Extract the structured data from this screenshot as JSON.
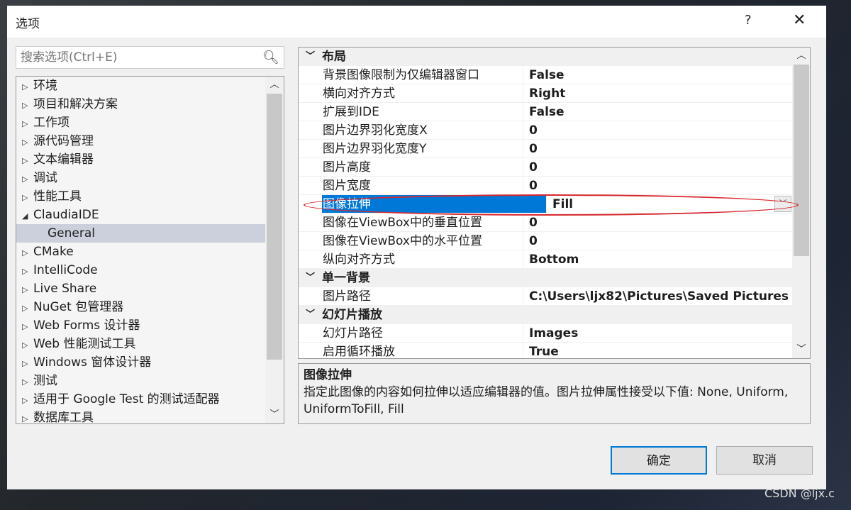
{
  "dialog": {
    "title": "选项",
    "help": "?",
    "close": "✕"
  },
  "search": {
    "placeholder": "搜索选项(Ctrl+E)"
  },
  "tree": {
    "items": [
      {
        "label": "环境",
        "arrow": "▷"
      },
      {
        "label": "项目和解决方案",
        "arrow": "▷"
      },
      {
        "label": "工作项",
        "arrow": "▷"
      },
      {
        "label": "源代码管理",
        "arrow": "▷"
      },
      {
        "label": "文本编辑器",
        "arrow": "▷"
      },
      {
        "label": "调试",
        "arrow": "▷"
      },
      {
        "label": "性能工具",
        "arrow": "▷"
      },
      {
        "label": "ClaudiaIDE",
        "arrow": "◢"
      },
      {
        "label": "General",
        "arrow": ""
      },
      {
        "label": "CMake",
        "arrow": "▷"
      },
      {
        "label": "IntelliCode",
        "arrow": "▷"
      },
      {
        "label": "Live Share",
        "arrow": "▷"
      },
      {
        "label": "NuGet 包管理器",
        "arrow": "▷"
      },
      {
        "label": "Web Forms 设计器",
        "arrow": "▷"
      },
      {
        "label": "Web 性能测试工具",
        "arrow": "▷"
      },
      {
        "label": "Windows 窗体设计器",
        "arrow": "▷"
      },
      {
        "label": "测试",
        "arrow": "▷"
      },
      {
        "label": "适用于 Google Test 的测试适配器",
        "arrow": "▷"
      },
      {
        "label": "数据库工具",
        "arrow": "▷"
      }
    ],
    "selected": "General"
  },
  "grid": {
    "rows": [
      {
        "cat": "布局"
      },
      {
        "name": "背景图像限制为仅编辑器窗口",
        "value": "False"
      },
      {
        "name": "横向对齐方式",
        "value": "Right"
      },
      {
        "name": "扩展到IDE",
        "value": "False"
      },
      {
        "name": "图片边界羽化宽度X",
        "value": "0"
      },
      {
        "name": "图片边界羽化宽度Y",
        "value": "0"
      },
      {
        "name": "图片高度",
        "value": "0"
      },
      {
        "name": "图片宽度",
        "value": "0"
      },
      {
        "name": "图像拉伸",
        "value": "Fill",
        "selected": true
      },
      {
        "name": "图像在ViewBox中的垂直位置",
        "value": "0"
      },
      {
        "name": "图像在ViewBox中的水平位置",
        "value": "0"
      },
      {
        "name": "纵向对齐方式",
        "value": "Bottom"
      },
      {
        "cat": "单一背景"
      },
      {
        "name": "图片路径",
        "value": "C:\\Users\\ljx82\\Pictures\\Saved Pictures"
      },
      {
        "cat": "幻灯片播放"
      },
      {
        "name": "幻灯片路径",
        "value": "Images"
      },
      {
        "name": "启用循环播放",
        "value": "True"
      }
    ]
  },
  "description": {
    "title": "图像拉伸",
    "text": "指定此图像的内容如何拉伸以适应编辑器的值。图片拉伸属性接受以下值: None, Uniform, UniformToFill, Fill"
  },
  "buttons": {
    "ok": "确定",
    "cancel": "取消"
  },
  "watermark": "CSDN @ljx.c",
  "colors": {
    "selection": "#0078d7",
    "annotation": "#d7282f"
  }
}
